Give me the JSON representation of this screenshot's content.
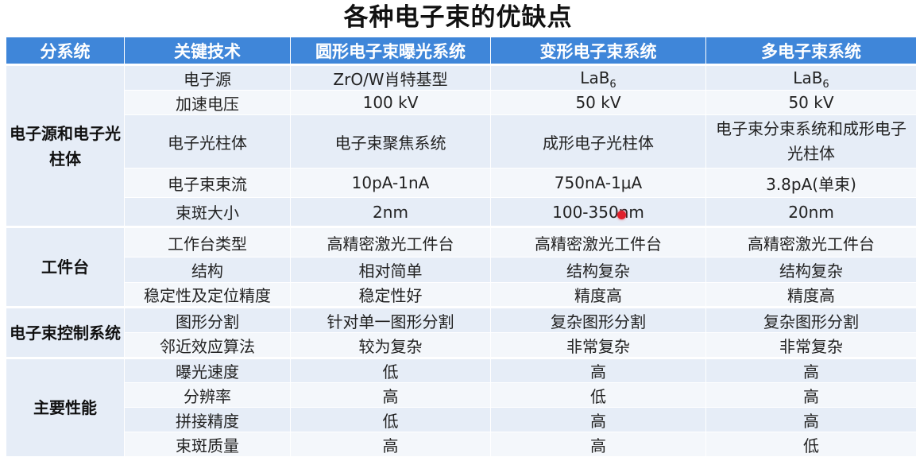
{
  "title": "各种电子束的优缺点",
  "header": [
    "分系统",
    "关键技术",
    "圆形电子束曝光系统",
    "变形电子束系统",
    "多电子束系统"
  ],
  "groups": {
    "g1": "电子源和电子光柱体",
    "g2": "工件台",
    "g3": "电子束控制系统",
    "g4": "主要性能"
  },
  "rows": {
    "r1": {
      "key": "电子源",
      "a": "ZrO/W肖特基型",
      "b_base": "LaB",
      "b_sub": "6",
      "c_base": "LaB",
      "c_sub": "6"
    },
    "r2": {
      "key": "加速电压",
      "a": "100 kV",
      "b": "50 kV",
      "c": "50 kV"
    },
    "r3": {
      "key": "电子光柱体",
      "a": "电子束聚焦系统",
      "b": "成形电子光柱体",
      "c": "电子束分束系统和成形电子光柱体"
    },
    "r4": {
      "key": "电子束束流",
      "a": "10pA-1nA",
      "b": "750nA-1μA",
      "c": "3.8pA(单束)"
    },
    "r5": {
      "key": "束斑大小",
      "a": "2nm",
      "b": "100-350nm",
      "c": "20nm"
    },
    "r6": {
      "key": "工作台类型",
      "a": "高精密激光工件台",
      "b": "高精密激光工件台",
      "c": "高精密激光工件台"
    },
    "r7": {
      "key": "结构",
      "a": "相对简单",
      "b": "结构复杂",
      "c": "结构复杂"
    },
    "r8": {
      "key": "稳定性及定位精度",
      "a": "稳定性好",
      "b": "精度高",
      "c": "精度高"
    },
    "r9": {
      "key": "图形分割",
      "a": "针对单一图形分割",
      "b": "复杂图形分割",
      "c": "复杂图形分割"
    },
    "r10": {
      "key": "邻近效应算法",
      "a": "较为复杂",
      "b": "非常复杂",
      "c": "非常复杂"
    },
    "r11": {
      "key": "曝光速度",
      "a": "低",
      "b": "高",
      "c": "高"
    },
    "r12": {
      "key": "分辨率",
      "a": "高",
      "b": "低",
      "c": "高"
    },
    "r13": {
      "key": "拼接精度",
      "a": "低",
      "b": "高",
      "c": "高"
    },
    "r14": {
      "key": "束斑质量",
      "a": "高",
      "b": "高",
      "c": "低"
    }
  },
  "colors": {
    "header_bg": "#3f86d9",
    "row_band": "#e6edf7",
    "row_alt": "#f4f7fb",
    "pointer": "#e0202c"
  }
}
